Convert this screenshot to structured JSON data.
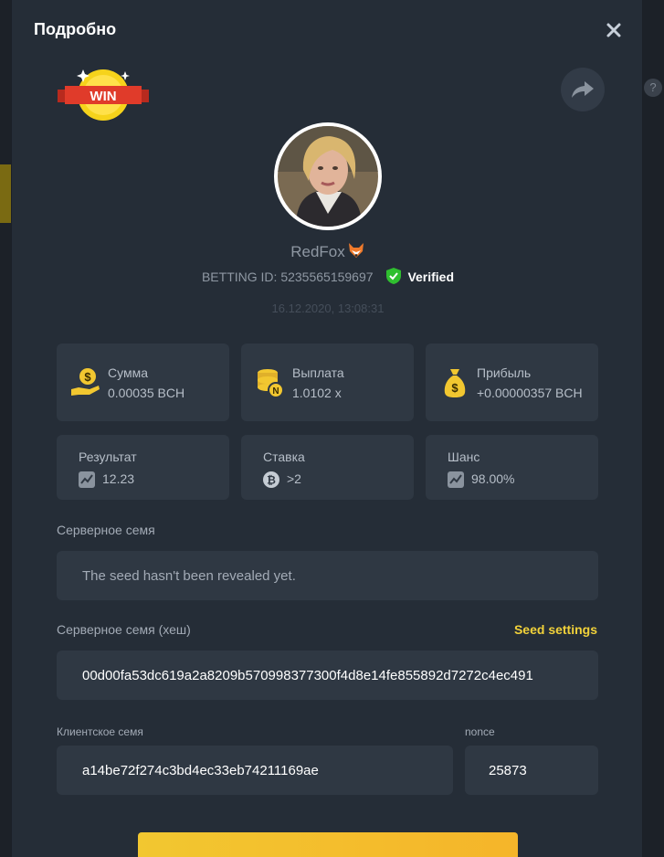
{
  "modal": {
    "title": "Подробно",
    "win_label": "WIN"
  },
  "player": {
    "username": "RedFox",
    "betting_id_label": "BETTING ID:",
    "betting_id": "5235565159697",
    "verified_label": "Verified",
    "timestamp": "16.12.2020, 13:08:31"
  },
  "stats": [
    {
      "label": "Сумма",
      "value": "0.00035 BCH",
      "icon": "money-hand-icon"
    },
    {
      "label": "Выплата",
      "value": "1.0102 x",
      "icon": "coin-stack-icon"
    },
    {
      "label": "Прибыль",
      "value": "+0.00000357 BCH",
      "icon": "money-bag-icon"
    },
    {
      "label": "Результат",
      "value": "12.23",
      "icon": "dice-chart-icon"
    },
    {
      "label": "Ставка",
      "value": ">2",
      "icon": "bitcoin-icon"
    },
    {
      "label": "Шанс",
      "value": "98.00%",
      "icon": "dice-chart-icon"
    }
  ],
  "server_seed": {
    "label": "Серверное семя",
    "value": "The seed hasn't been revealed yet."
  },
  "server_seed_hash": {
    "label": "Серверное семя (хеш)",
    "value": "00d00fa53dc619a2a8209b570998377300f4d8e14fe855892d7272c4ec491",
    "settings_link": "Seed settings"
  },
  "client_seed": {
    "label": "Клиентское семя",
    "value": "a14be72f274c3bd4ec33eb74211169ae"
  },
  "nonce": {
    "label": "nonce",
    "value": "25873"
  },
  "colors": {
    "modal_bg": "#252d37",
    "card_bg": "#2f3843",
    "accent_yellow": "#f2d23a",
    "verified_green": "#2fbf2f"
  }
}
